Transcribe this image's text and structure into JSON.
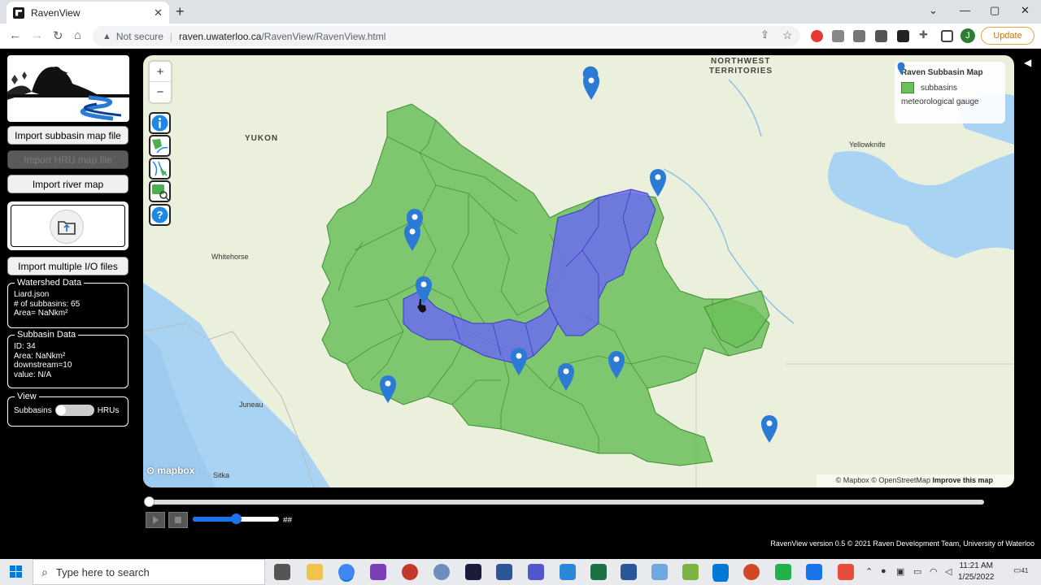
{
  "browser": {
    "tab_title": "RavenView",
    "new_tab": "+",
    "security": "Not secure",
    "url_host": "raven.uwaterloo.ca",
    "url_path": "/RavenView/RavenView.html",
    "avatar_letter": "J",
    "update_label": "Update"
  },
  "sidebar": {
    "import_subbasin": "Import subbasin map file",
    "import_hru": "Import HRU map file",
    "import_river": "Import river map",
    "import_multiple": "Import multiple I/O files"
  },
  "watershed": {
    "legend": "Watershed Data",
    "file": "Liard.json",
    "subbasins": "# of subbasins: 65",
    "area": "Area= NaNkm²"
  },
  "subbasin": {
    "legend": "Subbasin Data",
    "id": "ID: 34",
    "area": "Area: NaNkm²",
    "downstream": "downstream=10",
    "value": "value: N/A"
  },
  "view": {
    "legend": "View",
    "left": "Subbasins",
    "right": "HRUs"
  },
  "map": {
    "zoom_in": "+",
    "zoom_out": "−",
    "legend_title": "Raven Subbasin Map",
    "legend_subbasins": "subbasins",
    "legend_gauge": "meteorological gauge",
    "label_nwt": "NORTHWEST",
    "label_nwt2": "TERRITORIES",
    "label_yukon": "YUKON",
    "city_whitehorse": "Whitehorse",
    "city_yellowknife": "Yellowknife",
    "city_juneau": "Juneau",
    "city_sitka": "Sitka",
    "mapbox": "mapbox",
    "attribution": "© Mapbox © OpenStreetMap",
    "improve": "Improve this map",
    "colors": {
      "subbasin": "#6cbf5a",
      "selected": "#6b6bf0",
      "gauge": "#2b7bd6"
    }
  },
  "player": {
    "speed_value": "##",
    "speed_level": 0.5
  },
  "footer": "RavenView version 0.5 © 2021 Raven Development Team, University of Waterloo",
  "taskbar": {
    "search_placeholder": "Type here to search",
    "time": "11:21 AM",
    "date": "1/25/2022",
    "notifications": "41"
  }
}
